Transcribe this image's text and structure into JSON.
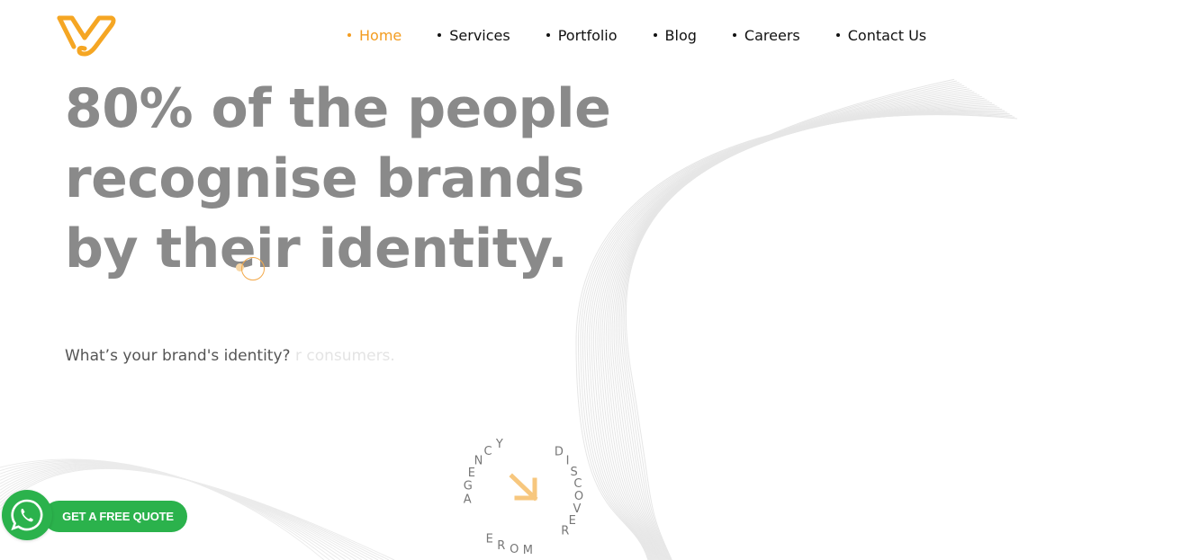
{
  "brand": {
    "logo_icon": "brand-logo-icon",
    "accent": "#f39c1f",
    "accent_light": "#f7c77e"
  },
  "nav": {
    "items": [
      {
        "label": "Home",
        "active": true
      },
      {
        "label": "Services"
      },
      {
        "label": "Portfolio"
      },
      {
        "label": "Blog"
      },
      {
        "label": "Careers"
      },
      {
        "label": "Contact Us"
      }
    ],
    "active_color": "#f39c1f",
    "text_color": "#111111"
  },
  "hero": {
    "title_lines": [
      "80% of the people",
      "recognise brands",
      "by their identity."
    ],
    "title_color": "#8a8a8a",
    "tagline": "What’s your brand's identity?",
    "tagline_ghost": "r consumers."
  },
  "discover": {
    "text_right": "DISCOVER",
    "text_bottom": "MORE",
    "text_left": "AGENCY",
    "arrow_icon": "arrow-down-right-icon"
  },
  "cta": {
    "quote_label": "GET A FREE QUOTE",
    "whatsapp_icon": "whatsapp-icon",
    "color": "#2bb24c"
  }
}
